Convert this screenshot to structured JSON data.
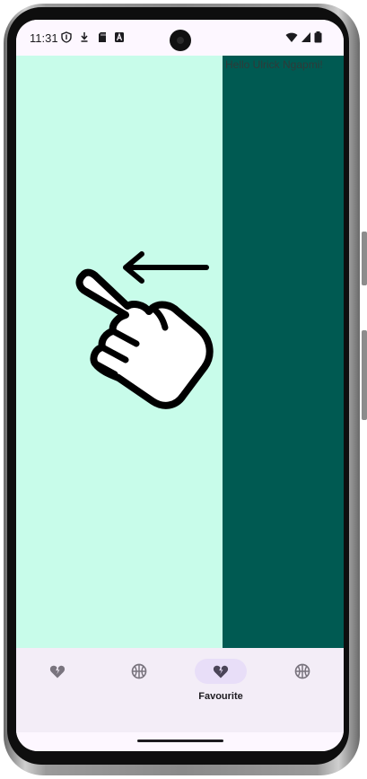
{
  "status_bar": {
    "time": "11:31",
    "left_icons": [
      "shield-icon",
      "download-icon",
      "sd-card-icon",
      "a-icon"
    ],
    "right_icons": [
      "wifi-icon",
      "signal-icon",
      "battery-icon"
    ]
  },
  "content": {
    "left_pane_color": "#c8fcea",
    "right_pane_color": "#005a52",
    "right_pane_text": "Hello Ulrick Ngapmi!",
    "gesture_hint_icon": "swipe-left-hand-icon"
  },
  "bottom_nav": {
    "active_index": 2,
    "items": [
      {
        "icon": "broken-heart-icon",
        "label": ""
      },
      {
        "icon": "basketball-icon",
        "label": ""
      },
      {
        "icon": "broken-heart-icon",
        "label": "Favourite"
      },
      {
        "icon": "basketball-icon",
        "label": ""
      }
    ]
  },
  "colors": {
    "nav_background": "#f3edf7",
    "nav_indicator": "#e8def8",
    "nav_icon": "#79747e",
    "nav_icon_active": "#4a4458"
  }
}
